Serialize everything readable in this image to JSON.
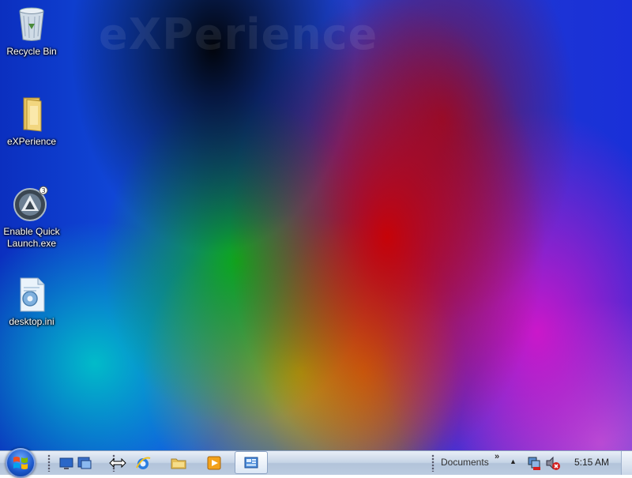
{
  "desktop": {
    "watermark": "eXPerience",
    "icons": [
      {
        "label": "Recycle Bin",
        "icon": "recycle-bin-icon"
      },
      {
        "label": "eXPerience",
        "icon": "folder-icon"
      },
      {
        "label": "Enable Quick Launch.exe",
        "icon": "executable-icon"
      },
      {
        "label": "desktop.ini",
        "icon": "settings-file-icon"
      }
    ]
  },
  "taskbar": {
    "toolbar_label": "Documents",
    "overflow_chevron": "»",
    "tray_expand": "▲",
    "clock": "5:15 AM",
    "quick_launch": [
      "show-desktop-icon",
      "switch-windows-icon",
      "resize-cursor-icon",
      "internet-explorer-icon",
      "windows-explorer-icon",
      "media-player-icon"
    ],
    "active_task_icon": "control-panel-icon",
    "tray_icons": [
      "network-icon",
      "volume-muted-icon"
    ]
  },
  "colors": {
    "taskbar_bg": "#c6d4e6",
    "start_orb": "#1b56c9"
  }
}
